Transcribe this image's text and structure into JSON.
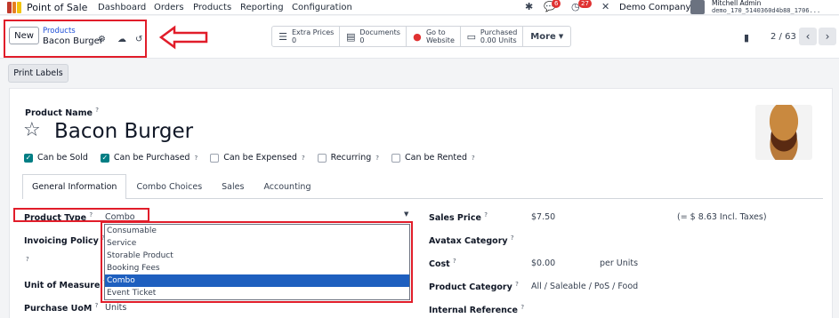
{
  "navbar": {
    "app_name": "Point of Sale",
    "menu": [
      "Dashboard",
      "Orders",
      "Products",
      "Reporting",
      "Configuration"
    ],
    "chat_badge": "6",
    "activity_badge": "27",
    "company": "Demo Company",
    "user_name": "Mitchell Admin",
    "user_db": "demo_170_5140360d4b88_1706..."
  },
  "control": {
    "new_label": "New",
    "breadcrumb": "Products",
    "record_name": "Bacon Burger",
    "smart_buttons": [
      {
        "icon": "list-icon",
        "label": "Extra Prices",
        "value": "0"
      },
      {
        "icon": "document-icon",
        "label": "Documents",
        "value": "0"
      },
      {
        "icon": "globe-icon",
        "label": "Go to",
        "value": "Website"
      },
      {
        "icon": "purchased-icon",
        "label": "Purchased",
        "value": "0.00 Units"
      }
    ],
    "more_label": "More",
    "pager": "2 / 63"
  },
  "print_labels": "Print Labels",
  "form": {
    "product_name_label": "Product Name",
    "help_mark": "?",
    "product_name": "Bacon Burger",
    "checkboxes": [
      {
        "label": "Can be Sold",
        "checked": true
      },
      {
        "label": "Can be Purchased",
        "checked": true
      },
      {
        "label": "Can be Expensed",
        "checked": false
      },
      {
        "label": "Recurring",
        "checked": false
      },
      {
        "label": "Can be Rented",
        "checked": false
      }
    ],
    "tabs": [
      "General Information",
      "Combo Choices",
      "Sales",
      "Accounting"
    ],
    "product_type_label": "Product Type",
    "product_type_value": "Combo",
    "invoicing_policy_label": "Invoicing Policy",
    "uom_label": "Unit of Measure",
    "purchase_uom_label": "Purchase UoM",
    "purchase_uom_value": "Units",
    "sales_price_label": "Sales Price",
    "sales_price_value": "$7.50",
    "incl_taxes": "(= $ 8.63 Incl. Taxes)",
    "avatax_label": "Avatax Category",
    "cost_label": "Cost",
    "cost_value": "$0.00",
    "cost_unit": "per Units",
    "category_label": "Product Category",
    "category_value": "All / Saleable / PoS / Food",
    "internal_ref_label": "Internal Reference"
  },
  "dropdown_options": [
    "Consumable",
    "Service",
    "Storable Product",
    "Booking Fees",
    "Combo",
    "Event Ticket"
  ],
  "colors": {
    "highlight": "#e11d2a",
    "accent": "#017e84",
    "selected": "#1e5fbf"
  }
}
